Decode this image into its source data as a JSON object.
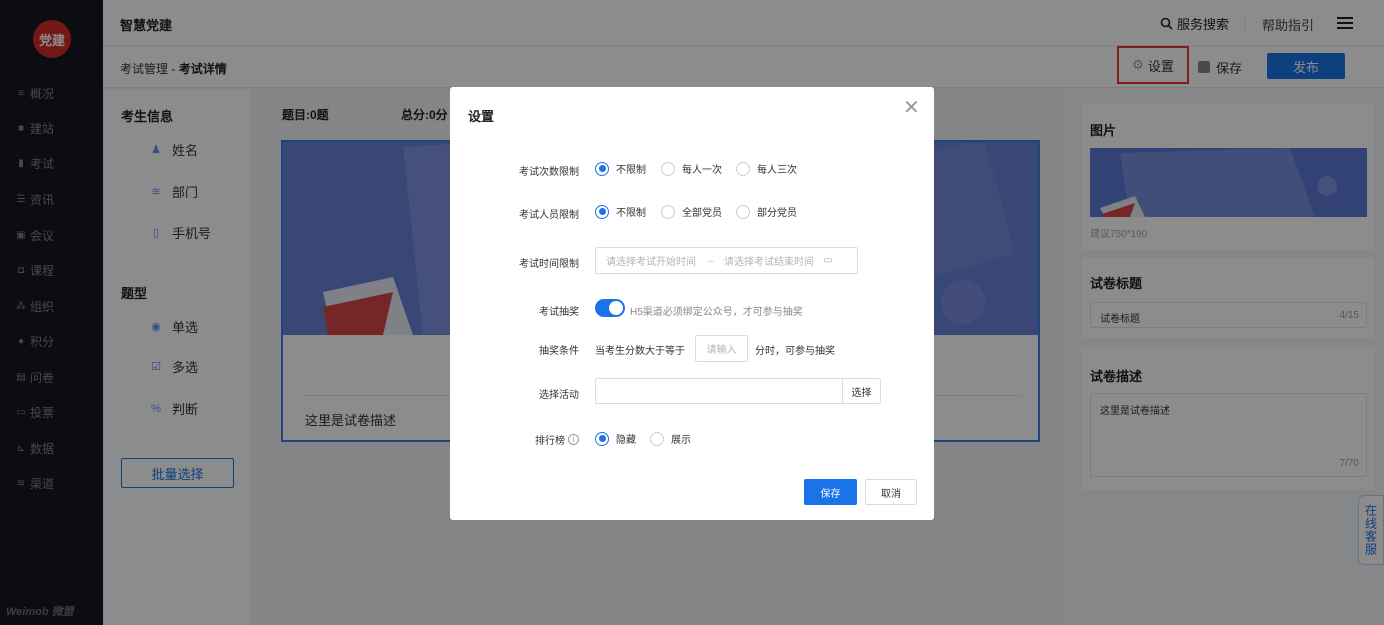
{
  "app": {
    "title": "智慧党建",
    "logo_text": "党建",
    "brand": "Weimob 微盟"
  },
  "header": {
    "search_label": "服务搜索",
    "help_label": "帮助指引"
  },
  "breadcrumb": {
    "parent": "考试管理",
    "separator": " - ",
    "current": "考试详情"
  },
  "toolbar": {
    "settings_label": "设置",
    "save_label": "保存",
    "publish_label": "发布"
  },
  "sidebar": {
    "items": [
      {
        "label": "概况",
        "icon": "menu-icon"
      },
      {
        "label": "建站",
        "icon": "grid-icon"
      },
      {
        "label": "考试",
        "icon": "book-icon"
      },
      {
        "label": "资讯",
        "icon": "news-icon"
      },
      {
        "label": "会议",
        "icon": "meeting-icon"
      },
      {
        "label": "课程",
        "icon": "course-icon"
      },
      {
        "label": "组织",
        "icon": "org-icon"
      },
      {
        "label": "积分",
        "icon": "points-icon"
      },
      {
        "label": "问卷",
        "icon": "survey-icon"
      },
      {
        "label": "投票",
        "icon": "vote-icon"
      },
      {
        "label": "数据",
        "icon": "chart-icon"
      },
      {
        "label": "渠道",
        "icon": "channel-icon"
      }
    ]
  },
  "left_panel": {
    "candidate_title": "考生信息",
    "candidate_fields": [
      {
        "label": "姓名",
        "icon": "person-icon"
      },
      {
        "label": "部门",
        "icon": "layers-icon"
      },
      {
        "label": "手机号",
        "icon": "phone-icon"
      }
    ],
    "qtype_title": "题型",
    "qtypes": [
      {
        "label": "单选",
        "icon": "radio-icon"
      },
      {
        "label": "多选",
        "icon": "checkbox-icon"
      },
      {
        "label": "判断",
        "icon": "judge-icon"
      }
    ],
    "batch_button": "批量选择"
  },
  "center": {
    "question_count": "题目:0题",
    "total_score": "总分:0分",
    "description": "这里是试卷描述"
  },
  "right_panel": {
    "image_title": "图片",
    "image_hint": "建议750*190",
    "paper_title_label": "试卷标题",
    "paper_title_value": "试卷标题",
    "paper_title_count": "4/15",
    "paper_desc_label": "试卷描述",
    "paper_desc_value": "这里是试卷描述",
    "paper_desc_count": "7/70"
  },
  "chat_label": "在线客服",
  "modal": {
    "title": "设置",
    "attempt_limit": {
      "label": "考试次数限制",
      "options": [
        "不限制",
        "每人一次",
        "每人三次"
      ],
      "selected": 0
    },
    "people_limit": {
      "label": "考试人员限制",
      "options": [
        "不限制",
        "全部党员",
        "部分党员"
      ],
      "selected": 0
    },
    "time_limit": {
      "label": "考试时间限制",
      "start_placeholder": "请选择考试开始时间",
      "arrow": "→",
      "end_placeholder": "请选择考试结束时间"
    },
    "lottery": {
      "label": "考试抽奖",
      "enabled": true,
      "hint": "H5渠道必须绑定公众号，才可参与抽奖"
    },
    "lottery_condition": {
      "label": "抽奖条件",
      "prefix": "当考生分数大于等于",
      "placeholder": "请输入",
      "suffix": "分时，可参与抽奖"
    },
    "activity": {
      "label": "选择活动",
      "value": "",
      "button": "选择"
    },
    "ranking": {
      "label": "排行榜",
      "options": [
        "隐藏",
        "展示"
      ],
      "selected": 0
    },
    "save_button": "保存",
    "cancel_button": "取消"
  }
}
